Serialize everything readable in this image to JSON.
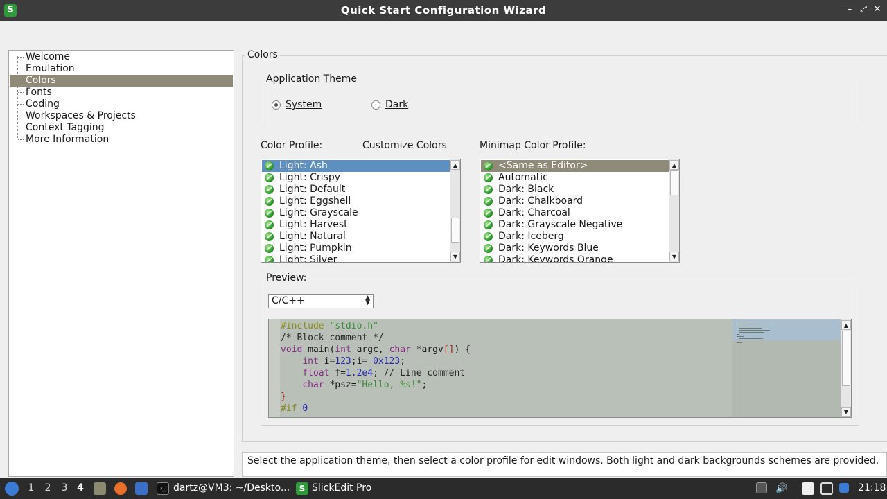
{
  "window": {
    "title": "Quick Start Configuration Wizard",
    "app_icon": "slickedit-icon",
    "controls": {
      "minimize": "–",
      "maximize": "⤢",
      "close": "✕"
    }
  },
  "tree": {
    "items": [
      "Welcome",
      "Emulation",
      "Colors",
      "Fonts",
      "Coding",
      "Workspaces & Projects",
      "Context Tagging",
      "More Information"
    ],
    "selected": "Colors"
  },
  "colors_group": {
    "title": "Colors"
  },
  "theme": {
    "title": "Application Theme",
    "options": [
      "System",
      "Dark"
    ],
    "selected": "System"
  },
  "color_profile": {
    "label": "Color Profile:",
    "customize_link": "Customize Colors",
    "items": [
      "Light: Ash",
      "Light: Crispy",
      "Light: Default",
      "Light: Eggshell",
      "Light: Grayscale",
      "Light: Harvest",
      "Light: Natural",
      "Light: Pumpkin",
      "Light: Silver"
    ],
    "selected": "Light: Ash"
  },
  "minimap_profile": {
    "label": "Minimap Color Profile:",
    "items": [
      "<Same as Editor>",
      "Automatic",
      "Dark: Black",
      "Dark: Chalkboard",
      "Dark: Charcoal",
      "Dark: Grayscale Negative",
      "Dark: Iceberg",
      "Dark: Keywords Blue",
      "Dark: Keywords Orange"
    ],
    "selected": "<Same as Editor>"
  },
  "preview": {
    "title": "Preview:",
    "language": "C/C++",
    "code_lines": [
      [
        {
          "t": "#include ",
          "c": "#8a8a1a"
        },
        {
          "t": "\"stdio.h\"",
          "c": "#3b8a3b"
        }
      ],
      [
        {
          "t": "/* Block comment */",
          "c": "#2a2a2a"
        }
      ],
      [
        {
          "t": "void ",
          "c": "#8a2a8a"
        },
        {
          "t": "main(",
          "c": "#1a1a1a"
        },
        {
          "t": "int ",
          "c": "#8a2a8a"
        },
        {
          "t": "argc, ",
          "c": "#1a1a1a"
        },
        {
          "t": "char ",
          "c": "#8a2a8a"
        },
        {
          "t": "*argv",
          "c": "#1a1a1a"
        },
        {
          "t": "[]",
          "c": "#a02020"
        },
        {
          "t": ") {",
          "c": "#1a1a1a"
        }
      ],
      [
        {
          "t": "    ",
          "c": "#1a1a1a"
        },
        {
          "t": "int ",
          "c": "#8a2a8a"
        },
        {
          "t": "i=",
          "c": "#1a1a1a"
        },
        {
          "t": "123",
          "c": "#2a2ab0"
        },
        {
          "t": ";i= ",
          "c": "#1a1a1a"
        },
        {
          "t": "0x123",
          "c": "#2a2ab0"
        },
        {
          "t": ";",
          "c": "#1a1a1a"
        }
      ],
      [
        {
          "t": "    ",
          "c": "#1a1a1a"
        },
        {
          "t": "float ",
          "c": "#8a2a8a"
        },
        {
          "t": "f=",
          "c": "#1a1a1a"
        },
        {
          "t": "1.2e4",
          "c": "#2a2ab0"
        },
        {
          "t": "; // Line comment",
          "c": "#2a2a2a"
        }
      ],
      [
        {
          "t": "    ",
          "c": "#1a1a1a"
        },
        {
          "t": "char ",
          "c": "#8a2a8a"
        },
        {
          "t": "*psz=",
          "c": "#1a1a1a"
        },
        {
          "t": "\"Hello, %s!\"",
          "c": "#3b8a3b"
        },
        {
          "t": ";",
          "c": "#1a1a1a"
        }
      ],
      [
        {
          "t": "}",
          "c": "#a02020"
        }
      ],
      [
        {
          "t": "#if ",
          "c": "#8a8a1a"
        },
        {
          "t": "0",
          "c": "#2a2ab0"
        }
      ]
    ]
  },
  "status_text": "Select the application theme, then select a color profile for edit windows. Both light and dark backgrounds schemes are provided.",
  "taskbar": {
    "workspaces": [
      "1",
      "2",
      "3",
      "4"
    ],
    "active_workspace": "4",
    "tasks": [
      {
        "label": "dartz@VM3: ~/Deskto...",
        "icon": "terminal-icon"
      },
      {
        "label": "SlickEdit Pro",
        "icon": "slickedit-icon"
      }
    ],
    "clock": "21:18"
  },
  "colors": {
    "selection_gray": "#908b78",
    "selection_blue": "#5d8fc0",
    "editor_bg": "#b9c0b7",
    "taskbar_bg": "#2b2b2b"
  }
}
